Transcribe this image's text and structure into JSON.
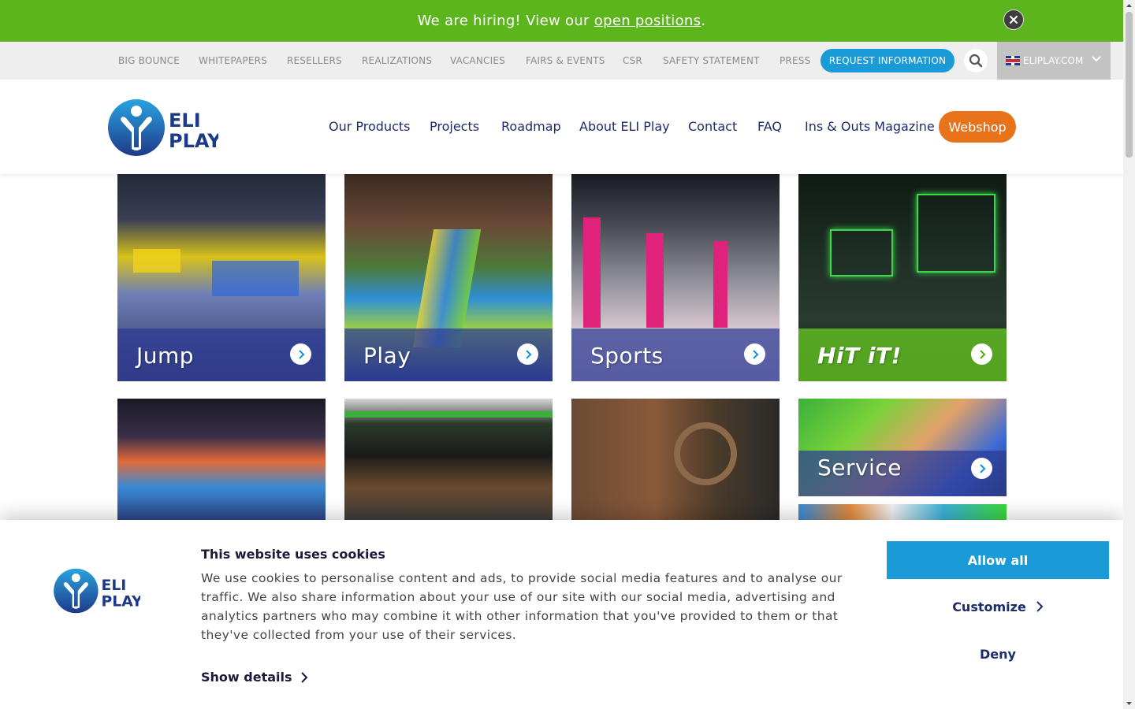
{
  "hiring_banner": {
    "prefix": "We are hiring! View our ",
    "link": "open positions",
    "suffix": "."
  },
  "utility_nav": {
    "links": [
      "BIG BOUNCE",
      "WHITEPAPERS",
      "RESELLERS",
      "REALIZATIONS",
      "VACANCIES",
      "FAIRS & EVENTS",
      "CSR",
      "SAFETY STATEMENT",
      "PRESS"
    ],
    "request_button": "REQUEST INFORMATION",
    "language": "ELIPLAY.COM"
  },
  "brand": {
    "line1": "ELI",
    "line2": "PLAY"
  },
  "main_nav": {
    "items": [
      "Our Products",
      "Projects",
      "Roadmap",
      "About ELI Play",
      "Contact",
      "FAQ",
      "Ins & Outs Magazine"
    ],
    "webshop": "Webshop"
  },
  "tiles": [
    {
      "label": "Jump"
    },
    {
      "label": "Play"
    },
    {
      "label": "Sports"
    },
    {
      "label": "HiT iT!"
    },
    {
      "label": "Service"
    }
  ],
  "cookie_banner": {
    "title": "This website uses cookies",
    "body": "We use cookies to personalise content and ads, to provide social media features and to analyse our traffic. We also share information about your use of our site with our social media, advertising and analytics partners who may combine it with other information that you've provided to them or that they've collected from your use of their services.",
    "show_details": "Show details",
    "allow_all": "Allow all",
    "customize": "Customize",
    "deny": "Deny"
  },
  "colors": {
    "hiring_green": "#5cb51c",
    "primary_blue": "#1a9ad7",
    "navy": "#1d2b6b",
    "webshop_orange": "#e8731a"
  }
}
